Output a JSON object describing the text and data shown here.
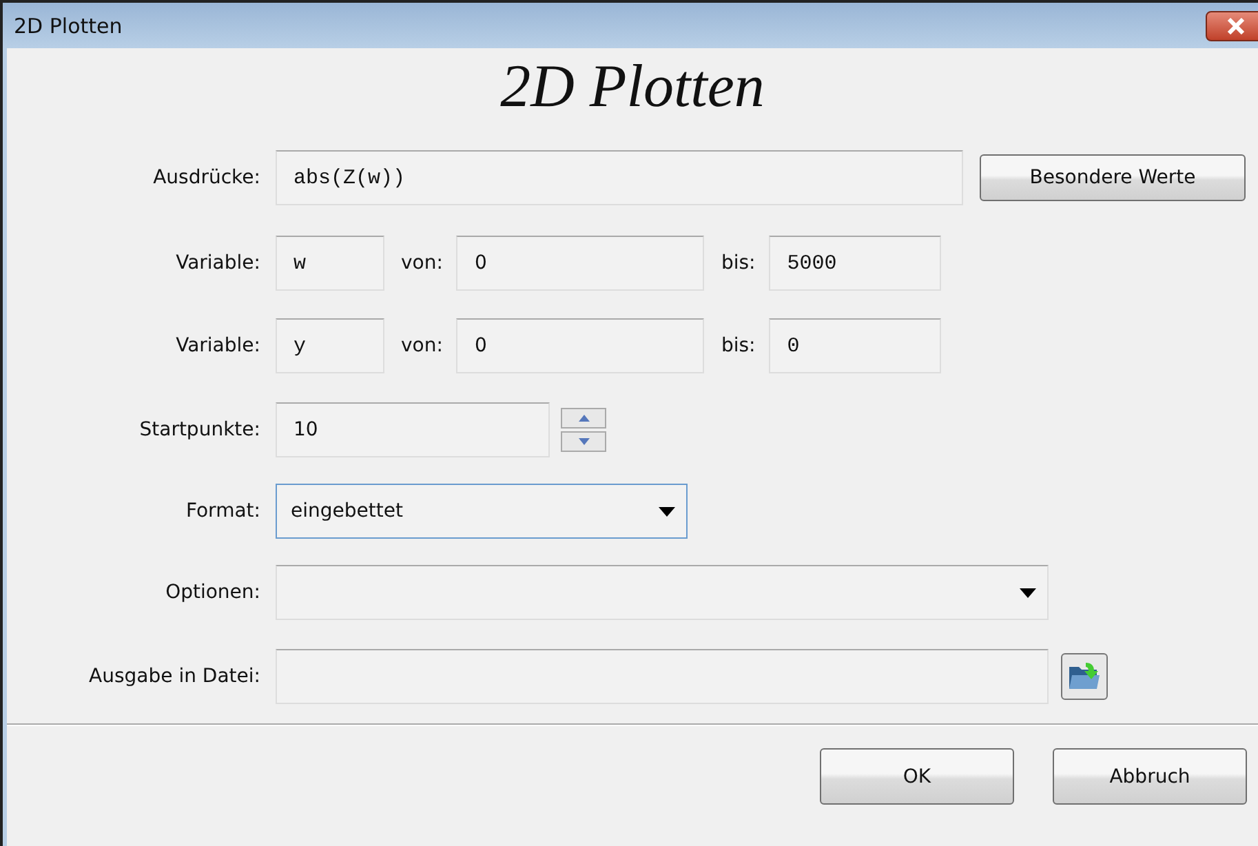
{
  "window": {
    "title": "2D Plotten"
  },
  "heading": "2D Plotten",
  "expression": {
    "label": "Ausdrücke:",
    "value": "abs(Z(w))",
    "button": "Besondere Werte"
  },
  "variables": [
    {
      "label": "Variable:",
      "name": "w",
      "from_label": "von:",
      "from": "0",
      "to_label": "bis:",
      "to": "5000"
    },
    {
      "label": "Variable:",
      "name": "y",
      "from_label": "von:",
      "from": "0",
      "to_label": "bis:",
      "to": "0"
    }
  ],
  "startpoints": {
    "label": "Startpunkte:",
    "value": "10"
  },
  "format": {
    "label": "Format:",
    "value": "eingebettet"
  },
  "options": {
    "label": "Optionen:"
  },
  "output_file": {
    "label": "Ausgabe in Datei:"
  },
  "buttons": [
    "OK",
    "Abbruch"
  ]
}
